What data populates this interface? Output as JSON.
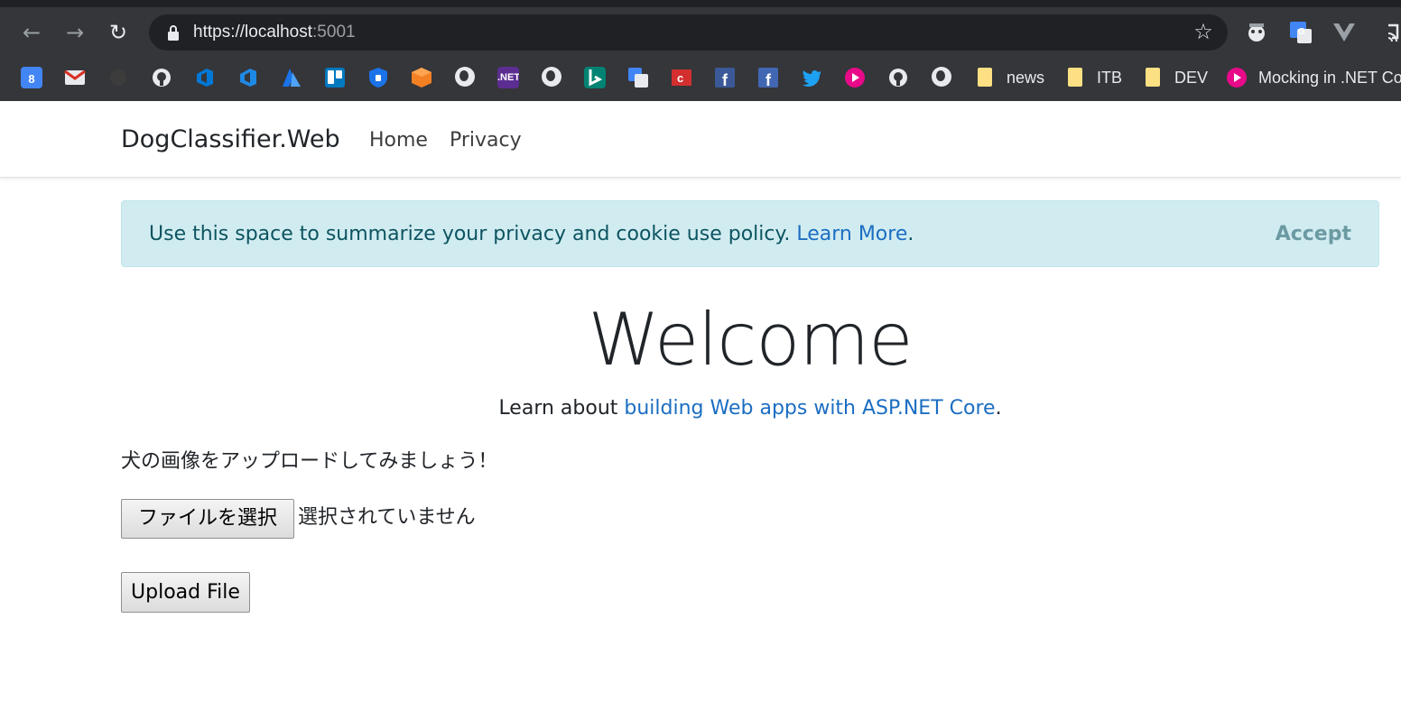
{
  "browser": {
    "url_scheme": "https://",
    "url_host": "localhost",
    "url_port": ":5001",
    "bookmarks": {
      "calendar_day": "8",
      "dotnet_label": ".NET",
      "folder_news": "news",
      "folder_itb": "ITB",
      "folder_dev": "DEV",
      "mocking_label": "Mocking in .NET Co..."
    },
    "icons": [
      "back-arrow-icon",
      "forward-arrow-icon",
      "reload-icon",
      "lock-icon",
      "star-icon",
      "extension-icon",
      "translate-icon",
      "vue-icon",
      "cast-icon"
    ]
  },
  "site": {
    "brand": "DogClassifier.Web",
    "nav": {
      "home": "Home",
      "privacy": "Privacy"
    },
    "cookie": {
      "text": "Use this space to summarize your privacy and cookie use policy. ",
      "link": "Learn More",
      "end": ".",
      "accept": "Accept"
    },
    "welcome": {
      "title": "Welcome",
      "learn_prefix": "Learn about ",
      "learn_link": "building Web apps with ASP.NET Core",
      "learn_suffix": "."
    },
    "upload": {
      "prompt": "犬の画像をアップロードしてみましょう！",
      "choose_label": "ファイルを選択",
      "no_file": "選択されていません",
      "upload_label": "Upload File"
    }
  },
  "colors": {
    "chrome_bg": "#35363a",
    "omnibox_bg": "#202124",
    "alert_bg": "#d1ecf1",
    "alert_text": "#0c5460",
    "link": "#1b6ec2"
  }
}
